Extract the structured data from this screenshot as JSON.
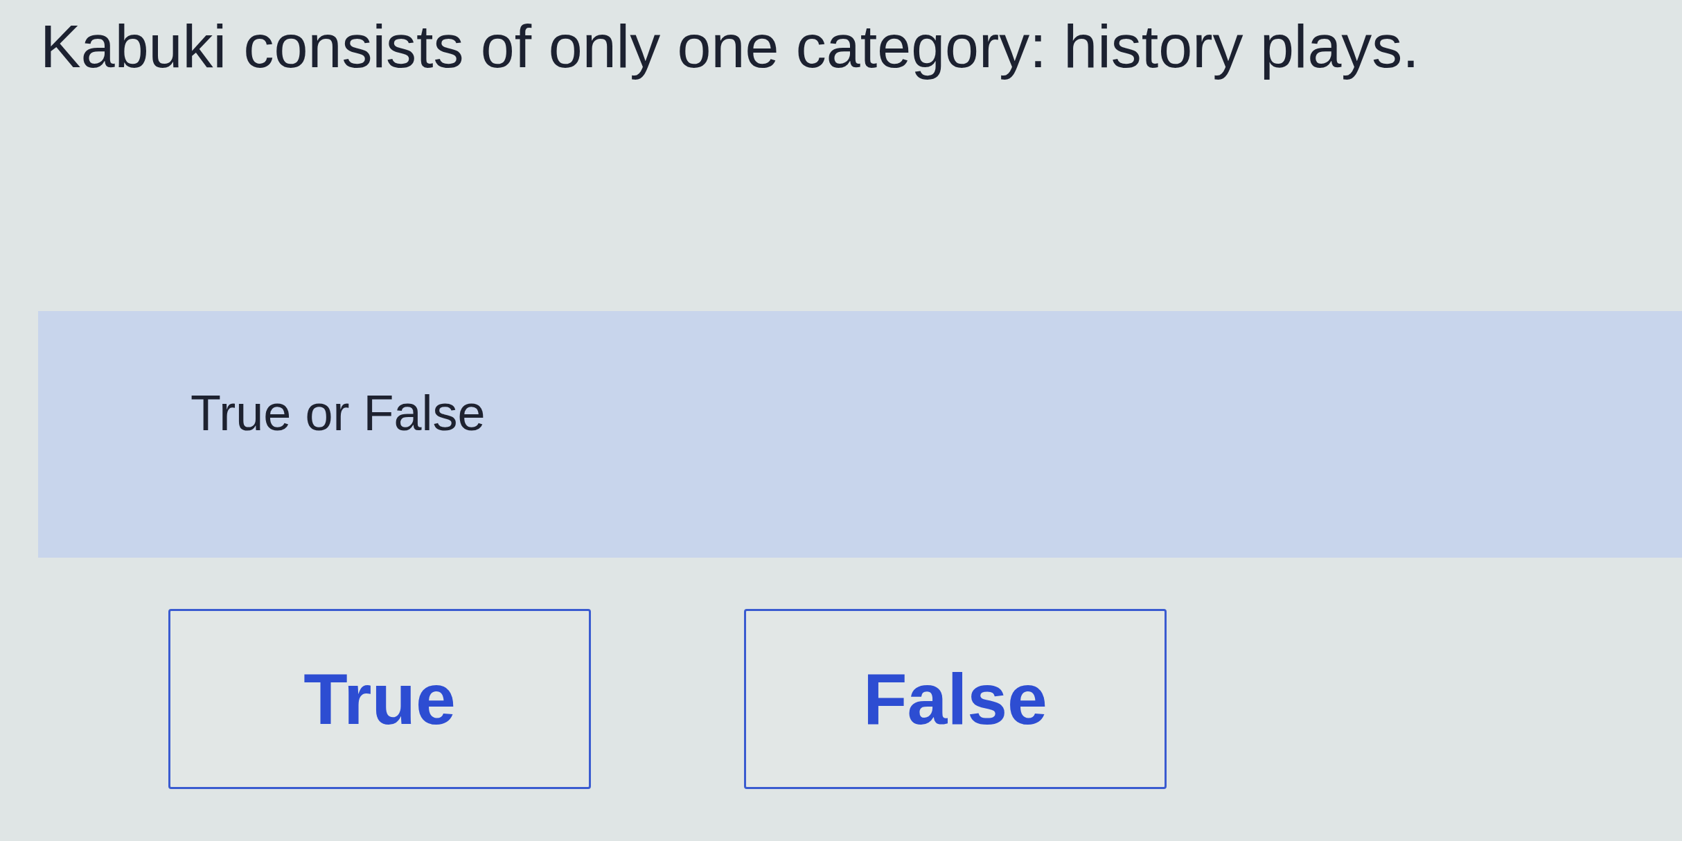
{
  "question": {
    "text": "Kabuki consists of only one category: history plays."
  },
  "prompt_panel": {
    "label": "True or False"
  },
  "answers": [
    {
      "label": "True"
    },
    {
      "label": "False"
    }
  ]
}
